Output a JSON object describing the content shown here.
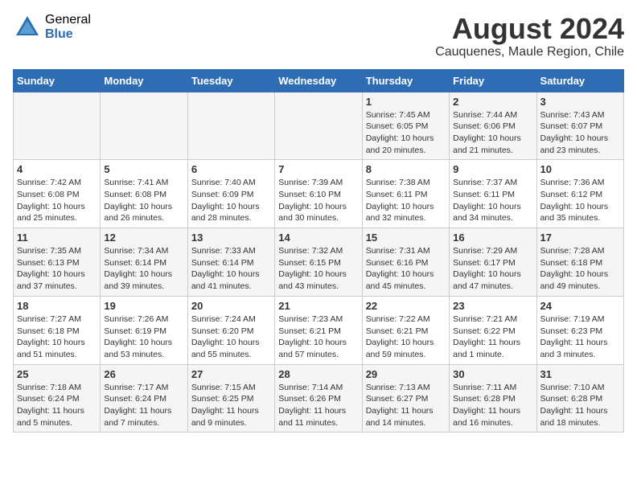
{
  "header": {
    "logo_general": "General",
    "logo_blue": "Blue",
    "month_year": "August 2024",
    "location": "Cauquenes, Maule Region, Chile"
  },
  "weekdays": [
    "Sunday",
    "Monday",
    "Tuesday",
    "Wednesday",
    "Thursday",
    "Friday",
    "Saturday"
  ],
  "weeks": [
    [
      {
        "day": "",
        "info": ""
      },
      {
        "day": "",
        "info": ""
      },
      {
        "day": "",
        "info": ""
      },
      {
        "day": "",
        "info": ""
      },
      {
        "day": "1",
        "info": "Sunrise: 7:45 AM\nSunset: 6:05 PM\nDaylight: 10 hours\nand 20 minutes."
      },
      {
        "day": "2",
        "info": "Sunrise: 7:44 AM\nSunset: 6:06 PM\nDaylight: 10 hours\nand 21 minutes."
      },
      {
        "day": "3",
        "info": "Sunrise: 7:43 AM\nSunset: 6:07 PM\nDaylight: 10 hours\nand 23 minutes."
      }
    ],
    [
      {
        "day": "4",
        "info": "Sunrise: 7:42 AM\nSunset: 6:08 PM\nDaylight: 10 hours\nand 25 minutes."
      },
      {
        "day": "5",
        "info": "Sunrise: 7:41 AM\nSunset: 6:08 PM\nDaylight: 10 hours\nand 26 minutes."
      },
      {
        "day": "6",
        "info": "Sunrise: 7:40 AM\nSunset: 6:09 PM\nDaylight: 10 hours\nand 28 minutes."
      },
      {
        "day": "7",
        "info": "Sunrise: 7:39 AM\nSunset: 6:10 PM\nDaylight: 10 hours\nand 30 minutes."
      },
      {
        "day": "8",
        "info": "Sunrise: 7:38 AM\nSunset: 6:11 PM\nDaylight: 10 hours\nand 32 minutes."
      },
      {
        "day": "9",
        "info": "Sunrise: 7:37 AM\nSunset: 6:11 PM\nDaylight: 10 hours\nand 34 minutes."
      },
      {
        "day": "10",
        "info": "Sunrise: 7:36 AM\nSunset: 6:12 PM\nDaylight: 10 hours\nand 35 minutes."
      }
    ],
    [
      {
        "day": "11",
        "info": "Sunrise: 7:35 AM\nSunset: 6:13 PM\nDaylight: 10 hours\nand 37 minutes."
      },
      {
        "day": "12",
        "info": "Sunrise: 7:34 AM\nSunset: 6:14 PM\nDaylight: 10 hours\nand 39 minutes."
      },
      {
        "day": "13",
        "info": "Sunrise: 7:33 AM\nSunset: 6:14 PM\nDaylight: 10 hours\nand 41 minutes."
      },
      {
        "day": "14",
        "info": "Sunrise: 7:32 AM\nSunset: 6:15 PM\nDaylight: 10 hours\nand 43 minutes."
      },
      {
        "day": "15",
        "info": "Sunrise: 7:31 AM\nSunset: 6:16 PM\nDaylight: 10 hours\nand 45 minutes."
      },
      {
        "day": "16",
        "info": "Sunrise: 7:29 AM\nSunset: 6:17 PM\nDaylight: 10 hours\nand 47 minutes."
      },
      {
        "day": "17",
        "info": "Sunrise: 7:28 AM\nSunset: 6:18 PM\nDaylight: 10 hours\nand 49 minutes."
      }
    ],
    [
      {
        "day": "18",
        "info": "Sunrise: 7:27 AM\nSunset: 6:18 PM\nDaylight: 10 hours\nand 51 minutes."
      },
      {
        "day": "19",
        "info": "Sunrise: 7:26 AM\nSunset: 6:19 PM\nDaylight: 10 hours\nand 53 minutes."
      },
      {
        "day": "20",
        "info": "Sunrise: 7:24 AM\nSunset: 6:20 PM\nDaylight: 10 hours\nand 55 minutes."
      },
      {
        "day": "21",
        "info": "Sunrise: 7:23 AM\nSunset: 6:21 PM\nDaylight: 10 hours\nand 57 minutes."
      },
      {
        "day": "22",
        "info": "Sunrise: 7:22 AM\nSunset: 6:21 PM\nDaylight: 10 hours\nand 59 minutes."
      },
      {
        "day": "23",
        "info": "Sunrise: 7:21 AM\nSunset: 6:22 PM\nDaylight: 11 hours\nand 1 minute."
      },
      {
        "day": "24",
        "info": "Sunrise: 7:19 AM\nSunset: 6:23 PM\nDaylight: 11 hours\nand 3 minutes."
      }
    ],
    [
      {
        "day": "25",
        "info": "Sunrise: 7:18 AM\nSunset: 6:24 PM\nDaylight: 11 hours\nand 5 minutes."
      },
      {
        "day": "26",
        "info": "Sunrise: 7:17 AM\nSunset: 6:24 PM\nDaylight: 11 hours\nand 7 minutes."
      },
      {
        "day": "27",
        "info": "Sunrise: 7:15 AM\nSunset: 6:25 PM\nDaylight: 11 hours\nand 9 minutes."
      },
      {
        "day": "28",
        "info": "Sunrise: 7:14 AM\nSunset: 6:26 PM\nDaylight: 11 hours\nand 11 minutes."
      },
      {
        "day": "29",
        "info": "Sunrise: 7:13 AM\nSunset: 6:27 PM\nDaylight: 11 hours\nand 14 minutes."
      },
      {
        "day": "30",
        "info": "Sunrise: 7:11 AM\nSunset: 6:28 PM\nDaylight: 11 hours\nand 16 minutes."
      },
      {
        "day": "31",
        "info": "Sunrise: 7:10 AM\nSunset: 6:28 PM\nDaylight: 11 hours\nand 18 minutes."
      }
    ]
  ]
}
